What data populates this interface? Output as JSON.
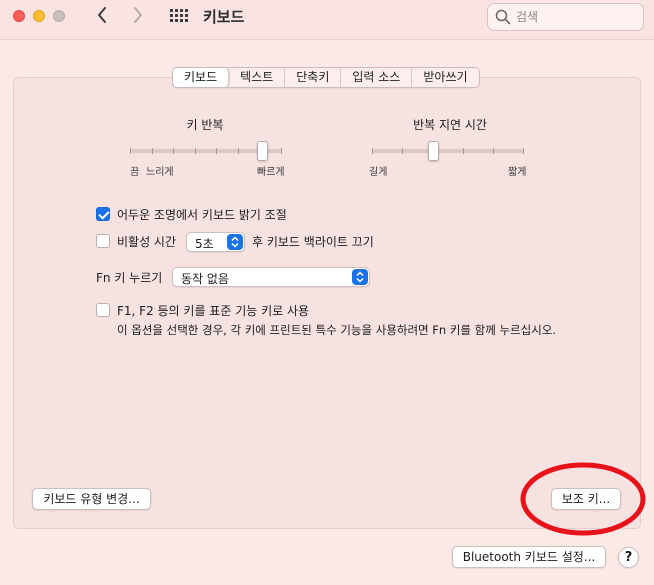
{
  "window": {
    "title": "키보드",
    "search_placeholder": "검색"
  },
  "tabs": [
    {
      "label": "키보드",
      "active": true
    },
    {
      "label": "텍스트",
      "active": false
    },
    {
      "label": "단축키",
      "active": false
    },
    {
      "label": "입력 소스",
      "active": false
    },
    {
      "label": "받아쓰기",
      "active": false
    }
  ],
  "key_repeat": {
    "title": "키 반복",
    "min_label": "끔",
    "slow_label": "느리게",
    "max_label": "빠르게",
    "tick_count": 8,
    "value_fraction": 0.9
  },
  "repeat_delay": {
    "title": "반복 지연 시간",
    "min_label": "길게",
    "max_label": "짧게",
    "tick_count": 6,
    "value_fraction": 0.4
  },
  "options": {
    "dim_light_checkbox": {
      "label": "어두운 조명에서 키보드 밝기 조절",
      "checked": true
    },
    "inactive_checkbox": {
      "label": "비활성 시간",
      "checked": false
    },
    "inactive_value": "5초",
    "inactive_suffix": "후 키보드 백라이트 끄기",
    "fn_label": "Fn 키 누르기",
    "fn_value": "동작 없음",
    "fkeys_checkbox": {
      "label": "F1, F2 등의 키를 표준 기능 키로 사용",
      "checked": false
    },
    "fkeys_description": "이 옵션을 선택한 경우, 각 키에 프린트된 특수 기능을 사용하려면 Fn 키를 함께 누르십시오."
  },
  "buttons": {
    "change_type": "키보드 유형 변경...",
    "modifier_keys": "보조 키...",
    "bluetooth": "Bluetooth 키보드 설정...",
    "help": "?"
  },
  "colors": {
    "accent": "#1a73e8",
    "annotation": "#e8121b",
    "background": "#fbe9e8"
  }
}
